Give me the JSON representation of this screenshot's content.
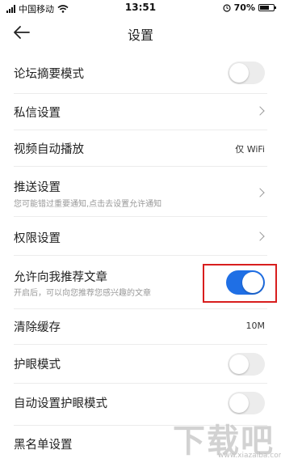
{
  "status_bar": {
    "carrier": "中国移动",
    "time": "13:51",
    "battery": "70%",
    "battery_level": 0.7
  },
  "header": {
    "title": "设置",
    "back_icon": "back-arrow-icon"
  },
  "settings": {
    "forum_summary": {
      "label": "论坛摘要模式",
      "toggle_on": false
    },
    "private_message": {
      "label": "私信设置"
    },
    "video_autoplay": {
      "label": "视频自动播放",
      "value": "仅 WiFi"
    },
    "push": {
      "label": "推送设置",
      "subtitle": "您可能错过重要通知,点击去设置允许通知"
    },
    "permissions": {
      "label": "权限设置"
    },
    "recommend": {
      "label": "允许向我推荐文章",
      "subtitle": "开启后，可以向您推荐您感兴趣的文章",
      "toggle_on": true
    },
    "clear_cache": {
      "label": "清除缓存",
      "value": "10M"
    },
    "eye_care": {
      "label": "护眼模式",
      "toggle_on": false
    },
    "auto_eye_care": {
      "label": "自动设置护眼模式",
      "toggle_on": false
    },
    "blacklist": {
      "label": "黑名单设置"
    }
  },
  "colors": {
    "toggle_on": "#1f6fe5",
    "toggle_off": "#ececec",
    "highlight_box": "#d81e1e"
  },
  "watermark": {
    "big": "下载吧",
    "small": "www.xiazaiba.com"
  }
}
